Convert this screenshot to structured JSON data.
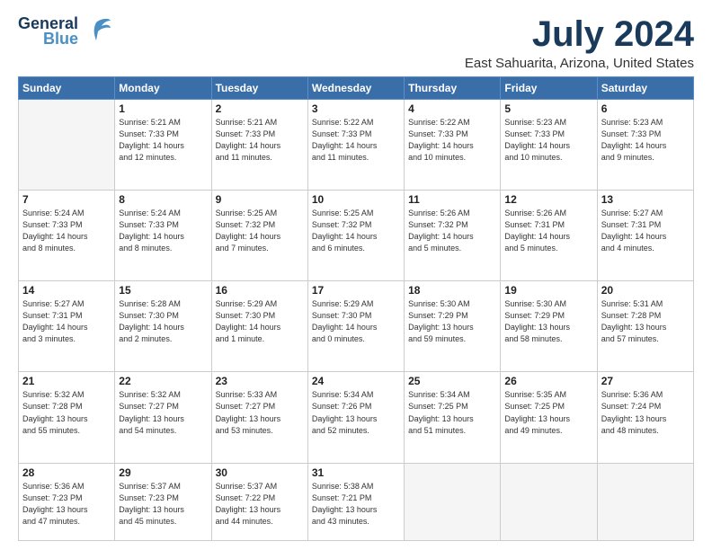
{
  "header": {
    "logo_line1": "General",
    "logo_line2": "Blue",
    "main_title": "July 2024",
    "subtitle": "East Sahuarita, Arizona, United States"
  },
  "days_of_week": [
    "Sunday",
    "Monday",
    "Tuesday",
    "Wednesday",
    "Thursday",
    "Friday",
    "Saturday"
  ],
  "weeks": [
    [
      {
        "day": "",
        "info": ""
      },
      {
        "day": "1",
        "info": "Sunrise: 5:21 AM\nSunset: 7:33 PM\nDaylight: 14 hours\nand 12 minutes."
      },
      {
        "day": "2",
        "info": "Sunrise: 5:21 AM\nSunset: 7:33 PM\nDaylight: 14 hours\nand 11 minutes."
      },
      {
        "day": "3",
        "info": "Sunrise: 5:22 AM\nSunset: 7:33 PM\nDaylight: 14 hours\nand 11 minutes."
      },
      {
        "day": "4",
        "info": "Sunrise: 5:22 AM\nSunset: 7:33 PM\nDaylight: 14 hours\nand 10 minutes."
      },
      {
        "day": "5",
        "info": "Sunrise: 5:23 AM\nSunset: 7:33 PM\nDaylight: 14 hours\nand 10 minutes."
      },
      {
        "day": "6",
        "info": "Sunrise: 5:23 AM\nSunset: 7:33 PM\nDaylight: 14 hours\nand 9 minutes."
      }
    ],
    [
      {
        "day": "7",
        "info": "Sunrise: 5:24 AM\nSunset: 7:33 PM\nDaylight: 14 hours\nand 8 minutes."
      },
      {
        "day": "8",
        "info": "Sunrise: 5:24 AM\nSunset: 7:33 PM\nDaylight: 14 hours\nand 8 minutes."
      },
      {
        "day": "9",
        "info": "Sunrise: 5:25 AM\nSunset: 7:32 PM\nDaylight: 14 hours\nand 7 minutes."
      },
      {
        "day": "10",
        "info": "Sunrise: 5:25 AM\nSunset: 7:32 PM\nDaylight: 14 hours\nand 6 minutes."
      },
      {
        "day": "11",
        "info": "Sunrise: 5:26 AM\nSunset: 7:32 PM\nDaylight: 14 hours\nand 5 minutes."
      },
      {
        "day": "12",
        "info": "Sunrise: 5:26 AM\nSunset: 7:31 PM\nDaylight: 14 hours\nand 5 minutes."
      },
      {
        "day": "13",
        "info": "Sunrise: 5:27 AM\nSunset: 7:31 PM\nDaylight: 14 hours\nand 4 minutes."
      }
    ],
    [
      {
        "day": "14",
        "info": "Sunrise: 5:27 AM\nSunset: 7:31 PM\nDaylight: 14 hours\nand 3 minutes."
      },
      {
        "day": "15",
        "info": "Sunrise: 5:28 AM\nSunset: 7:30 PM\nDaylight: 14 hours\nand 2 minutes."
      },
      {
        "day": "16",
        "info": "Sunrise: 5:29 AM\nSunset: 7:30 PM\nDaylight: 14 hours\nand 1 minute."
      },
      {
        "day": "17",
        "info": "Sunrise: 5:29 AM\nSunset: 7:30 PM\nDaylight: 14 hours\nand 0 minutes."
      },
      {
        "day": "18",
        "info": "Sunrise: 5:30 AM\nSunset: 7:29 PM\nDaylight: 13 hours\nand 59 minutes."
      },
      {
        "day": "19",
        "info": "Sunrise: 5:30 AM\nSunset: 7:29 PM\nDaylight: 13 hours\nand 58 minutes."
      },
      {
        "day": "20",
        "info": "Sunrise: 5:31 AM\nSunset: 7:28 PM\nDaylight: 13 hours\nand 57 minutes."
      }
    ],
    [
      {
        "day": "21",
        "info": "Sunrise: 5:32 AM\nSunset: 7:28 PM\nDaylight: 13 hours\nand 55 minutes."
      },
      {
        "day": "22",
        "info": "Sunrise: 5:32 AM\nSunset: 7:27 PM\nDaylight: 13 hours\nand 54 minutes."
      },
      {
        "day": "23",
        "info": "Sunrise: 5:33 AM\nSunset: 7:27 PM\nDaylight: 13 hours\nand 53 minutes."
      },
      {
        "day": "24",
        "info": "Sunrise: 5:34 AM\nSunset: 7:26 PM\nDaylight: 13 hours\nand 52 minutes."
      },
      {
        "day": "25",
        "info": "Sunrise: 5:34 AM\nSunset: 7:25 PM\nDaylight: 13 hours\nand 51 minutes."
      },
      {
        "day": "26",
        "info": "Sunrise: 5:35 AM\nSunset: 7:25 PM\nDaylight: 13 hours\nand 49 minutes."
      },
      {
        "day": "27",
        "info": "Sunrise: 5:36 AM\nSunset: 7:24 PM\nDaylight: 13 hours\nand 48 minutes."
      }
    ],
    [
      {
        "day": "28",
        "info": "Sunrise: 5:36 AM\nSunset: 7:23 PM\nDaylight: 13 hours\nand 47 minutes."
      },
      {
        "day": "29",
        "info": "Sunrise: 5:37 AM\nSunset: 7:23 PM\nDaylight: 13 hours\nand 45 minutes."
      },
      {
        "day": "30",
        "info": "Sunrise: 5:37 AM\nSunset: 7:22 PM\nDaylight: 13 hours\nand 44 minutes."
      },
      {
        "day": "31",
        "info": "Sunrise: 5:38 AM\nSunset: 7:21 PM\nDaylight: 13 hours\nand 43 minutes."
      },
      {
        "day": "",
        "info": ""
      },
      {
        "day": "",
        "info": ""
      },
      {
        "day": "",
        "info": ""
      }
    ]
  ]
}
